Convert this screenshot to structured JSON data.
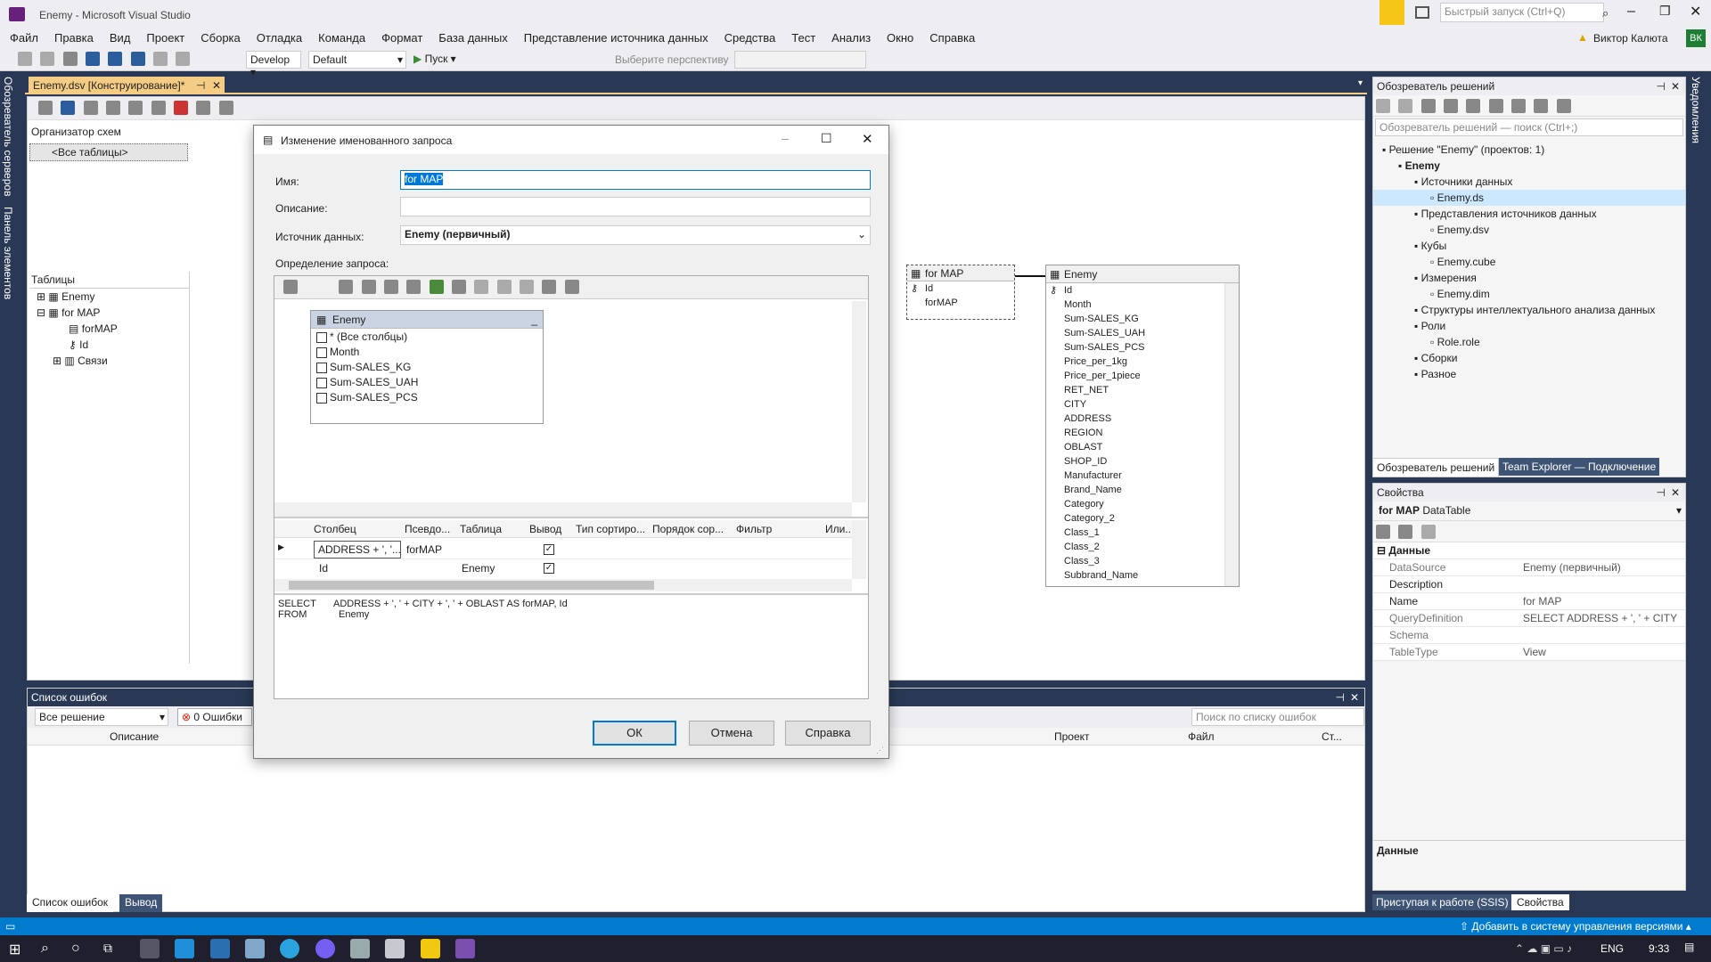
{
  "window": {
    "title": "Enemy - Microsoft Visual Studio"
  },
  "quick_launch": {
    "placeholder": "Быстрый запуск (Ctrl+Q)"
  },
  "user": {
    "name": "Виктор Калюта",
    "initials": "ВК"
  },
  "menu": [
    "Файл",
    "Правка",
    "Вид",
    "Проект",
    "Сборка",
    "Отладка",
    "Команда",
    "Формат",
    "База данных",
    "Представление источника данных",
    "Средства",
    "Тест",
    "Анализ",
    "Окно",
    "Справка"
  ],
  "toolbar": {
    "config": "Develop",
    "platform": "Default",
    "start": "Пуск",
    "perspective": "Выберите перспективу"
  },
  "doc_tab": {
    "label": "Enemy.dsv [Конструирование]*"
  },
  "left_vtabs": [
    "Обозреватель серверов",
    "Панель элементов"
  ],
  "right_vtabs": [
    "Уведомления"
  ],
  "schema_organizer": {
    "title": "Организатор схем",
    "item": "<Все таблицы>"
  },
  "tables_panel": {
    "title": "Таблицы",
    "items": [
      "Enemy",
      "for MAP",
      "forMAP",
      "Id",
      "Связи"
    ]
  },
  "diagram": {
    "formap_table": {
      "title": "for MAP",
      "columns": [
        "Id",
        "forMAP"
      ]
    },
    "enemy_table": {
      "title": "Enemy",
      "columns": [
        "Id",
        "Month",
        "Sum-SALES_KG",
        "Sum-SALES_UAH",
        "Sum-SALES_PCS",
        "Price_per_1kg",
        "Price_per_1piece",
        "RET_NET",
        "CITY",
        "ADDRESS",
        "REGION",
        "OBLAST",
        "SHOP_ID",
        "Manufacturer",
        "Brand_Name",
        "Category",
        "Category_2",
        "Class_1",
        "Class_2",
        "Class_3",
        "Subbrand_Name"
      ]
    }
  },
  "dialog": {
    "title": "Изменение именованного запроса",
    "name_label": "Имя:",
    "name_value": "for MAP",
    "desc_label": "Описание:",
    "desc_value": "",
    "source_label": "Источник данных:",
    "source_value": "Enemy (первичный)",
    "query_label": "Определение запроса:",
    "qtable": {
      "title": "Enemy",
      "columns": [
        "* (Все столбцы)",
        "Month",
        "Sum-SALES_KG",
        "Sum-SALES_UAH",
        "Sum-SALES_PCS"
      ]
    },
    "grid_headers": [
      "Столбец",
      "Псевдо...",
      "Таблица",
      "Вывод",
      "Тип сортиро...",
      "Порядок сор...",
      "Фильтр",
      "Или..."
    ],
    "grid_rows": [
      {
        "column": "ADDRESS + ', '...",
        "alias": "forMAP",
        "table": ""
      },
      {
        "column": "Id",
        "alias": "",
        "table": "Enemy"
      }
    ],
    "sql_line1_kw": "SELECT",
    "sql_line1": "ADDRESS + ', ' + CITY + ', ' + OBLAST AS forMAP, Id",
    "sql_line2_kw": "FROM",
    "sql_line2": "Enemy",
    "ok": "ОК",
    "cancel": "Отмена",
    "help": "Справка"
  },
  "error_list": {
    "title": "Список ошибок",
    "scope": "Все решение",
    "errors": "0 Ошибки",
    "search_placeholder": "Поиск по списку ошибок",
    "cols": [
      "Описание",
      "Проект",
      "Файл",
      "Ст..."
    ],
    "tabs": [
      "Список ошибок",
      "Вывод"
    ]
  },
  "solution_explorer": {
    "title": "Обозреватель решений",
    "search_placeholder": "Обозреватель решений — поиск (Ctrl+;)",
    "items": [
      {
        "label": "Решение \"Enemy\" (проектов: 1)",
        "indent": 0
      },
      {
        "label": "Enemy",
        "indent": 1,
        "bold": true
      },
      {
        "label": "Источники данных",
        "indent": 2
      },
      {
        "label": "Enemy.ds",
        "indent": 3,
        "selected": true
      },
      {
        "label": "Представления источников данных",
        "indent": 2
      },
      {
        "label": "Enemy.dsv",
        "indent": 3
      },
      {
        "label": "Кубы",
        "indent": 2
      },
      {
        "label": "Enemy.cube",
        "indent": 3
      },
      {
        "label": "Измерения",
        "indent": 2
      },
      {
        "label": "Enemy.dim",
        "indent": 3
      },
      {
        "label": "Структуры интеллектуального анализа данных",
        "indent": 2
      },
      {
        "label": "Роли",
        "indent": 2
      },
      {
        "label": "Role.role",
        "indent": 3
      },
      {
        "label": "Сборки",
        "indent": 2
      },
      {
        "label": "Разное",
        "indent": 2
      }
    ],
    "tabs": [
      "Обозреватель решений",
      "Team Explorer — Подключение"
    ]
  },
  "properties": {
    "title": "Свойства",
    "object": "for MAP",
    "object_type": "DataTable",
    "category": "Данные",
    "rows": [
      {
        "name": "DataSource",
        "value": "Enemy (первичный)"
      },
      {
        "name": "Description",
        "value": ""
      },
      {
        "name": "Name",
        "value": "for MAP"
      },
      {
        "name": "QueryDefinition",
        "value": "SELECT      ADDRESS + ', ' + CITY"
      },
      {
        "name": "Schema",
        "value": ""
      },
      {
        "name": "TableType",
        "value": "View"
      }
    ],
    "desc_title": "Данные",
    "tabs": [
      "Приступая к работе (SSIS)",
      "Свойства"
    ]
  },
  "status": {
    "vcs": "Добавить в систему управления версиями"
  },
  "taskbar": {
    "lang": "ENG",
    "time": "9:33"
  }
}
